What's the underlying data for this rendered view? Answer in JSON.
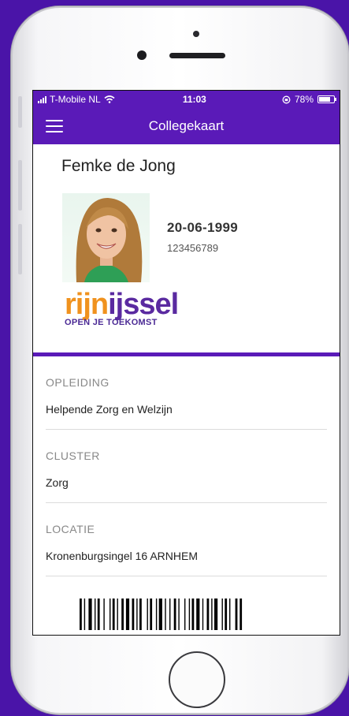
{
  "status_bar": {
    "carrier": "T-Mobile NL",
    "time": "11:03",
    "battery": "78%",
    "battery_level": 0.78
  },
  "navbar": {
    "title": "Collegekaart",
    "menu_icon": "hamburger-icon"
  },
  "card": {
    "name": "Femke de Jong",
    "birthdate": "20-06-1999",
    "student_number": "123456789",
    "logo": {
      "wordmark": "rijnijssel",
      "tagline": "OPEN JE TOEKOMST"
    }
  },
  "details": [
    {
      "label": "OPLEIDING",
      "value": "Helpende Zorg en Welzijn"
    },
    {
      "label": "CLUSTER",
      "value": "Zorg"
    },
    {
      "label": "LOCATIE",
      "value": "Kronenburgsingel 16 ARNHEM"
    }
  ],
  "colors": {
    "brand": "#5a1ab8",
    "logo_orange": "#f0921e",
    "logo_purple": "#5a2aa0"
  }
}
